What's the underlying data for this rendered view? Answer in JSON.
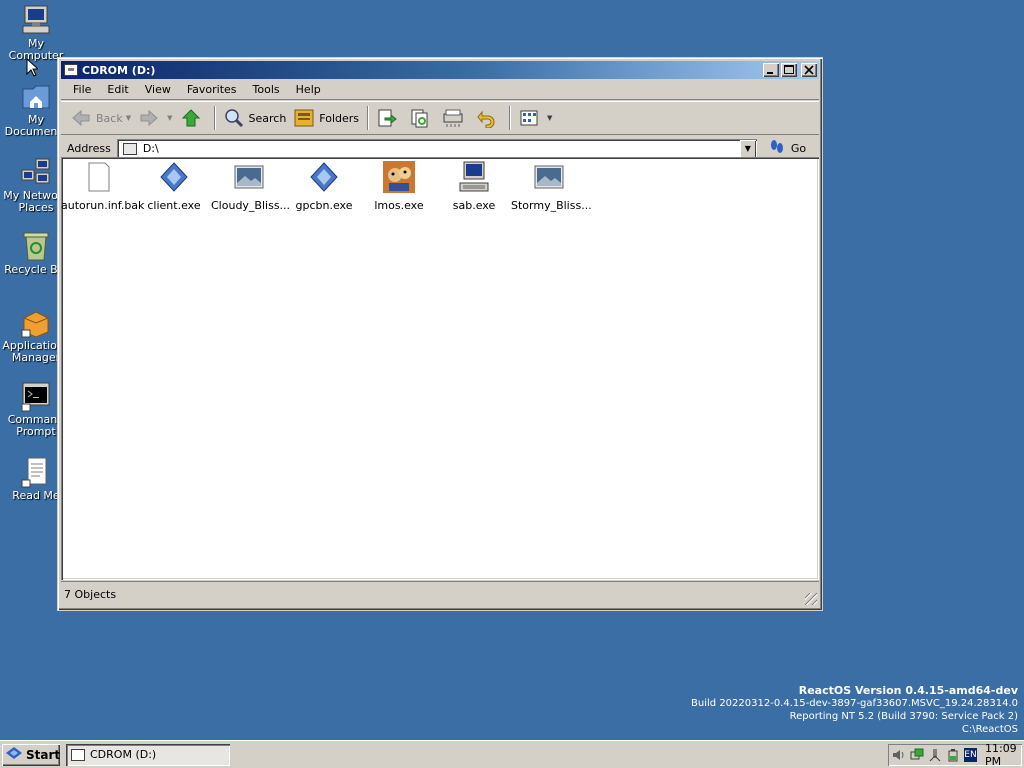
{
  "desktop": {
    "icons": [
      {
        "label": "My\nComputer",
        "icon": "my-computer-icon"
      },
      {
        "label": "My\nDocuments",
        "icon": "my-documents-icon"
      },
      {
        "label": "My Network\nPlaces",
        "icon": "network-places-icon"
      },
      {
        "label": "Recycle Bin",
        "icon": "recycle-bin-icon"
      },
      {
        "label": "Applications\nManager",
        "icon": "applications-manager-icon"
      },
      {
        "label": "Command\nPrompt",
        "icon": "command-prompt-icon"
      },
      {
        "label": "Read Me",
        "icon": "read-me-icon"
      }
    ]
  },
  "window": {
    "title": "CDROM (D:)",
    "menu": [
      "File",
      "Edit",
      "View",
      "Favorites",
      "Tools",
      "Help"
    ],
    "toolbar": {
      "back": "Back",
      "search": "Search",
      "folders": "Folders"
    },
    "address": {
      "label": "Address",
      "value": "D:\\",
      "go": "Go"
    },
    "files": [
      {
        "name": "autorun.inf.bak",
        "icon": "document-icon"
      },
      {
        "name": "client.exe",
        "icon": "executable-icon"
      },
      {
        "name": "Cloudy_Bliss...",
        "icon": "image-file-icon"
      },
      {
        "name": "gpcbn.exe",
        "icon": "executable-icon"
      },
      {
        "name": "lmos.exe",
        "icon": "app-icon"
      },
      {
        "name": "sab.exe",
        "icon": "computer-app-icon"
      },
      {
        "name": "Stormy_Bliss...",
        "icon": "image-file-icon"
      }
    ],
    "status": "7 Objects"
  },
  "watermark": {
    "line1": "ReactOS Version 0.4.15-amd64-dev",
    "line2": "Build 20220312-0.4.15-dev-3897-gaf33607.MSVC_19.24.28314.0",
    "line3": "Reporting NT 5.2 (Build 3790: Service Pack 2)",
    "line4": "C:\\ReactOS"
  },
  "taskbar": {
    "start": "Start",
    "task": "CDROM (D:)",
    "lang": "EN",
    "clock": "11:09 PM"
  },
  "colors": {
    "desktop": "#3a6ea5",
    "title_active": "#0a246a",
    "face": "#d4d0c8"
  }
}
